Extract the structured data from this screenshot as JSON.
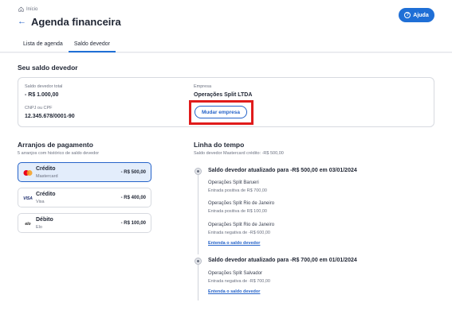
{
  "header": {
    "breadcrumb": "Início",
    "title": "Agenda financeira",
    "help_label": "Ajuda"
  },
  "tabs": [
    {
      "label": "Lista de agenda"
    },
    {
      "label": "Saldo devedor"
    }
  ],
  "debt": {
    "title": "Seu saldo devedor",
    "total_label": "Saldo devedor total",
    "total_value": "- R$ 1.000,00",
    "cnpj_label": "CNPJ ou CPF",
    "cnpj_value": "12.345.678/0001-90",
    "company_label": "Empresa",
    "company_value": "Operações Split LTDA",
    "change_button": "Mudar empresa"
  },
  "arrangements": {
    "title": "Arranjos de pagamento",
    "subtitle": "5 arranjos com histórico de saldo devedor",
    "items": [
      {
        "name": "Crédito",
        "brand": "Mastercard",
        "amount": "- R$ 500,00"
      },
      {
        "name": "Crédito",
        "brand": "Visa",
        "amount": "- R$ 400,00"
      },
      {
        "name": "Débito",
        "brand": "Elo",
        "amount": "- R$ 100,00"
      }
    ]
  },
  "timeline": {
    "title": "Linha do tempo",
    "subtitle": "Saldo devedor Mastercard crédito: -R$ 500,00",
    "events": [
      {
        "heading": "Saldo devedor atualizado para -R$ 500,00 em 03/01/2024",
        "entries": [
          {
            "name": "Operações Split Barueri",
            "note": "Entrada positiva de R$ 700,00"
          },
          {
            "name": "Operações Split Rio de Janeiro",
            "note": "Entrada positiva de R$ 100,00"
          },
          {
            "name": "Operações Split Rio de Janeiro",
            "note": "Entrada negativa de -R$ 600,00"
          }
        ],
        "link": "Entenda o saldo devedor"
      },
      {
        "heading": "Saldo devedor atualizado para -R$ 700,00 em 01/01/2024",
        "entries": [
          {
            "name": "Operações Split Salvador",
            "note": "Entrada negativa de -R$ 700,00"
          }
        ],
        "link": "Entenda o saldo devedor"
      }
    ]
  },
  "icons": {
    "home": "home-icon",
    "back": "arrow-left-icon",
    "help": "question-circle-icon",
    "mastercard": "mastercard-logo",
    "visa": "visa-logo",
    "elo": "elo-logo",
    "timeline_dot": "timeline-dot-icon"
  },
  "colors": {
    "accent": "#1f6fd6",
    "highlight_box": "#e01b1b",
    "selected_card_bg": "#e3edfb"
  }
}
